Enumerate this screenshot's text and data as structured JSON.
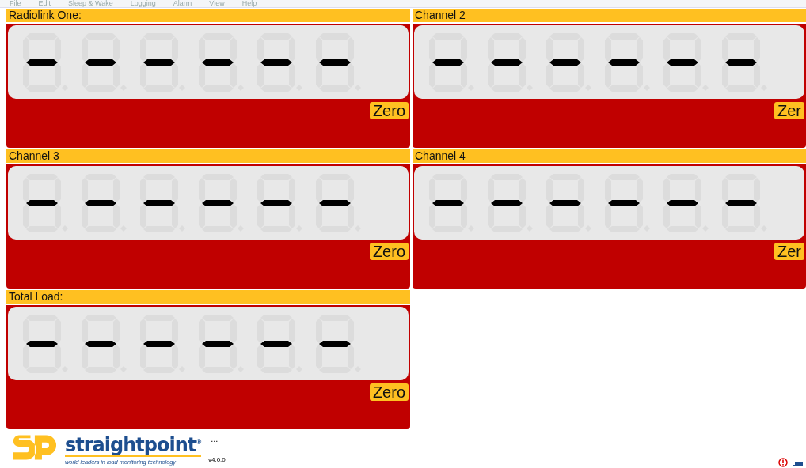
{
  "menu": [
    "File",
    "Edit",
    "Sleep & Wake",
    "Logging",
    "Alarm",
    "View",
    "Help"
  ],
  "panels": [
    {
      "title": "Radiolink One:",
      "button": "Zero"
    },
    {
      "title": "Channel 2",
      "button": "Zer"
    },
    {
      "title": "Channel 3",
      "button": "Zero"
    },
    {
      "title": "Channel 4",
      "button": "Zer"
    },
    {
      "title": "Total Load:",
      "button": "Zero"
    }
  ],
  "footer": {
    "brand": "straightpoint$^{®}$",
    "tagline": "world leaders in load monitoring technology",
    "ellipsis": "...",
    "version": "v4.0.0"
  }
}
